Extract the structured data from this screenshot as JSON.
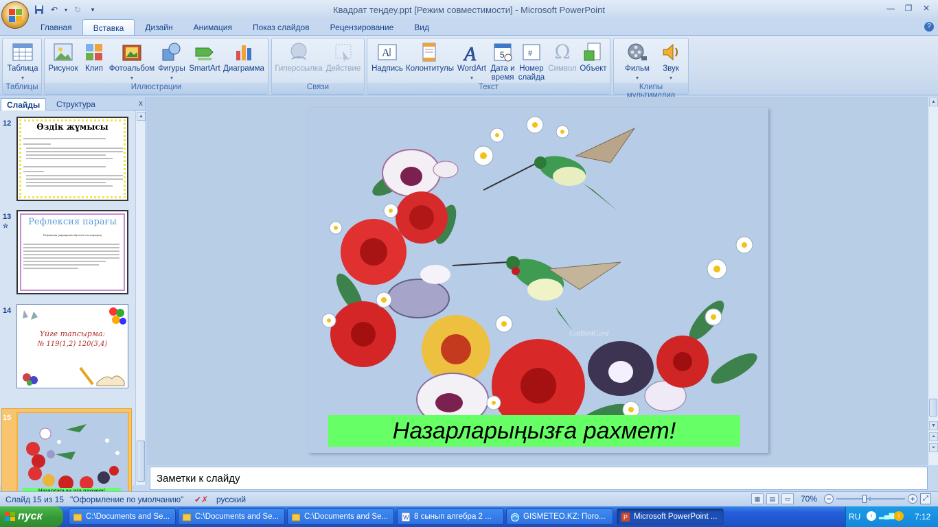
{
  "window": {
    "title": "Квадрат теңдеу.ppt [Режим совместимости] - Microsoft PowerPoint"
  },
  "ribbon_tabs": [
    "Главная",
    "Вставка",
    "Дизайн",
    "Анимация",
    "Показ слайдов",
    "Рецензирование",
    "Вид"
  ],
  "ribbon": {
    "groups": {
      "tables": "Таблицы",
      "illustrations": "Иллюстрации",
      "links": "Связи",
      "text": "Текст",
      "media": "Клипы мультимедиа"
    },
    "buttons": {
      "table": "Таблица",
      "picture": "Рисунок",
      "clip": "Клип",
      "photoalbum": "Фотоальбом",
      "shapes": "Фигуры",
      "smartart": "SmartArt",
      "chart": "Диаграмма",
      "hyperlink": "Гиперссылка",
      "action": "Действие",
      "textbox": "Надпись",
      "headerfooter": "Колонтитулы",
      "wordart": "WordArt",
      "datetime_1": "Дата и",
      "datetime_2": "время",
      "slidenum_1": "Номер",
      "slidenum_2": "слайда",
      "symbol": "Символ",
      "object": "Объект",
      "movie": "Фильм",
      "sound": "Звук"
    }
  },
  "left_panel": {
    "tab_slides": "Слайды",
    "tab_outline": "Структура",
    "close": "x",
    "slides": [
      {
        "num": "12",
        "title": "Өздік жұмысы"
      },
      {
        "num": "13",
        "title": "Рефлексия парағы",
        "subtitle": "Рефлексия (парақшаны бірлесіп толтырыңыз)"
      },
      {
        "num": "14",
        "line1": "Үйге тапсырма:",
        "line2": "№ 119(1,2) 120(3,4)"
      },
      {
        "num": "15",
        "caption": "Назарларыңызға рахмет!"
      }
    ]
  },
  "slide": {
    "caption": "Назарларыңызға рахмет!",
    "watermark": "CatBirdCard",
    "caption_bg": "#66ff66"
  },
  "notes": {
    "placeholder": "Заметки к слайду"
  },
  "statusbar": {
    "slide_info": "Слайд 15 из 15",
    "theme": "\"Оформление по умолчанию\"",
    "language": "русский",
    "zoom": "70%"
  },
  "taskbar": {
    "start": "пуск",
    "items": [
      "C:\\Documents and Se...",
      "C:\\Documents and Se...",
      "C:\\Documents and Se...",
      "8 сынып алгебра  2 ...",
      "GISMETEO.KZ: Пого...",
      "Microsoft PowerPoint ..."
    ],
    "lang": "RU",
    "time": "7:12"
  },
  "colors": {
    "accent": "#15428b",
    "ribbon_bg": "#dbe6f4",
    "taskbar": "#245edb",
    "start": "#379a36"
  }
}
